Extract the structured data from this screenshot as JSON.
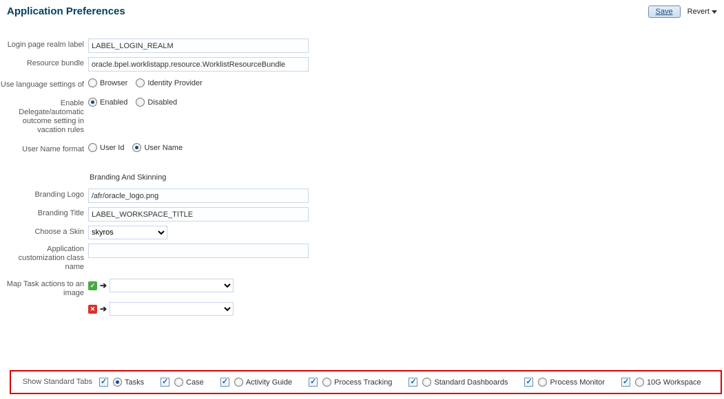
{
  "header": {
    "title": "Application Preferences",
    "save": "Save",
    "revert": "Revert"
  },
  "form": {
    "login_realm_label": "Login page realm label",
    "login_realm_value": "LABEL_LOGIN_REALM",
    "resource_bundle_label": "Resource bundle",
    "resource_bundle_value": "oracle.bpel.worklistapp.resource.WorklistResourceBundle",
    "use_lang_label": "Use language settings of",
    "use_lang_opts": {
      "browser": "Browser",
      "idp": "Identity Provider"
    },
    "enable_deleg_label": "Enable Delegate/automatic outcome setting in vacation rules",
    "enable_opts": {
      "enabled": "Enabled",
      "disabled": "Disabled"
    },
    "username_fmt_label": "User Name format",
    "username_opts": {
      "id": "User Id",
      "name": "User Name"
    }
  },
  "branding": {
    "section": "Branding And Skinning",
    "logo_label": "Branding Logo",
    "logo_value": "/afr/oracle_logo.png",
    "title_label": "Branding Title",
    "title_value": "LABEL_WORKSPACE_TITLE",
    "skin_label": "Choose a Skin",
    "skin_value": "skyros",
    "app_class_label": "Application customization class name",
    "app_class_value": "",
    "map_label": "Map Task actions to an image"
  },
  "tabs": {
    "label": "Show Standard Tabs",
    "items": [
      {
        "name": "Tasks",
        "checked": true,
        "selected": true
      },
      {
        "name": "Case",
        "checked": true,
        "selected": false
      },
      {
        "name": "Activity Guide",
        "checked": true,
        "selected": false
      },
      {
        "name": "Process Tracking",
        "checked": true,
        "selected": false
      },
      {
        "name": "Standard Dashboards",
        "checked": true,
        "selected": false
      },
      {
        "name": "Process Monitor",
        "checked": true,
        "selected": false
      },
      {
        "name": "10G Workspace",
        "checked": true,
        "selected": false
      }
    ]
  }
}
